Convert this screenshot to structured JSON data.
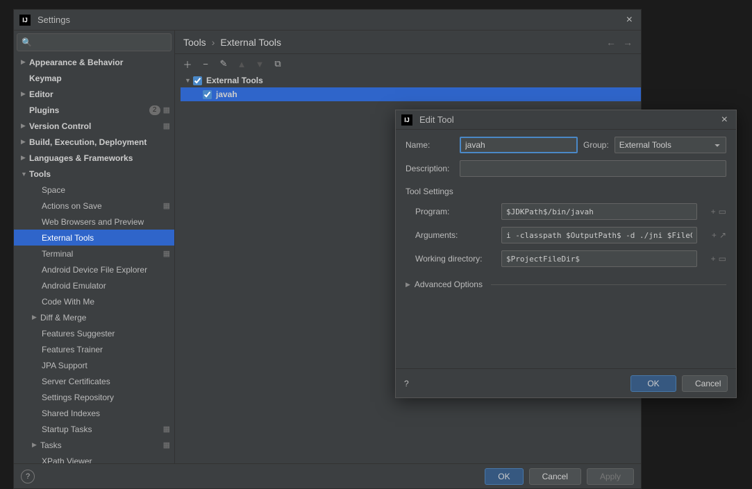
{
  "settings": {
    "title": "Settings",
    "search_placeholder": "",
    "breadcrumb": {
      "root": "Tools",
      "current": "External Tools"
    },
    "tree": {
      "appearance": "Appearance & Behavior",
      "keymap": "Keymap",
      "editor": "Editor",
      "plugins": "Plugins",
      "plugins_badge": "2",
      "version_control": "Version Control",
      "build": "Build, Execution, Deployment",
      "languages": "Languages & Frameworks",
      "tools": "Tools",
      "tools_children": {
        "space": "Space",
        "actions_on_save": "Actions on Save",
        "web_browsers": "Web Browsers and Preview",
        "external_tools": "External Tools",
        "terminal": "Terminal",
        "adb_file_explorer": "Android Device File Explorer",
        "android_emulator": "Android Emulator",
        "code_with_me": "Code With Me",
        "diff_merge": "Diff & Merge",
        "features_suggester": "Features Suggester",
        "features_trainer": "Features Trainer",
        "jpa_support": "JPA Support",
        "server_certificates": "Server Certificates",
        "settings_repository": "Settings Repository",
        "shared_indexes": "Shared Indexes",
        "startup_tasks": "Startup Tasks",
        "tasks": "Tasks",
        "xpath_viewer": "XPath Viewer"
      }
    },
    "tool_tree": {
      "group": "External Tools",
      "item": "javah"
    },
    "footer": {
      "ok": "OK",
      "cancel": "Cancel",
      "apply": "Apply"
    }
  },
  "dialog": {
    "title": "Edit Tool",
    "name_label": "Name:",
    "name_value": "javah",
    "group_label": "Group:",
    "group_value": "External Tools",
    "description_label": "Description:",
    "description_value": "",
    "section_tool_settings": "Tool Settings",
    "program_label": "Program:",
    "program_value": "$JDKPath$/bin/javah",
    "arguments_label": "Arguments:",
    "arguments_value": "i -classpath $OutputPath$ -d ./jni $FileClass$",
    "workdir_label": "Working directory:",
    "workdir_value": "$ProjectFileDir$",
    "advanced": "Advanced Options",
    "ok": "OK",
    "cancel": "Cancel"
  }
}
